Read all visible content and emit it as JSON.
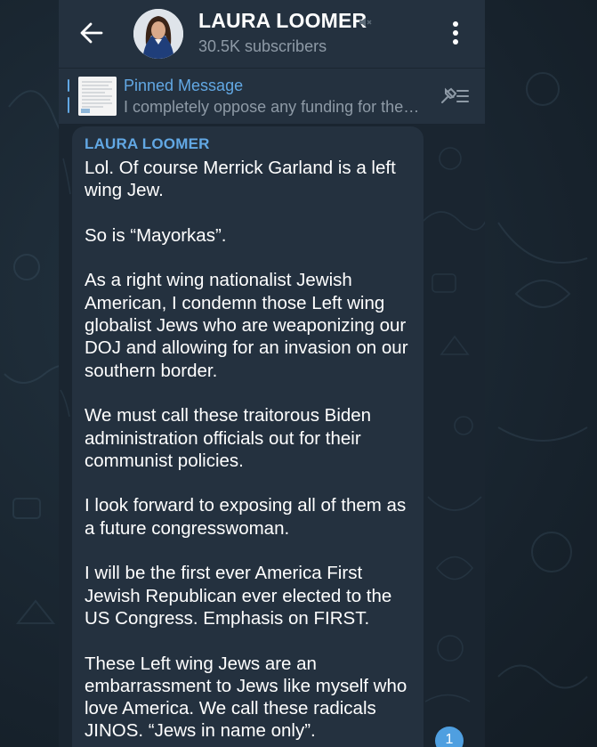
{
  "header": {
    "title": "LAURA LOOMER",
    "subscribers": "30.5K subscribers",
    "back_icon": "arrow-left-icon",
    "mute_icon": "muted-speaker-icon",
    "menu_icon": "more-vertical-icon"
  },
  "pinned": {
    "title": "Pinned Message",
    "preview": "I completely oppose any funding for the…",
    "list_icon": "pin-list-icon"
  },
  "message": {
    "sender": "LAURA LOOMER",
    "text": "Lol. Of course Merrick Garland is a left wing Jew.\n\nSo is “Mayorkas”.\n\nAs a right wing nationalist Jewish American, I condemn those Left wing globalist Jews who are weaponizing our DOJ and allowing for an invasion on our southern border.\n\nWe must call these traitorous Biden administration officials out for their communist policies.\n\nI look forward to exposing all of them as a future congresswoman.\n\nI will be the first ever America First Jewish Republican ever elected to the US Congress. Emphasis on FIRST.\n\nThese Left wing Jews are an embarrassment to Jews like myself who love America. We call these radicals JINOS. “Jews in name only”."
  },
  "scroll_badge": {
    "count": "1"
  },
  "colors": {
    "accent": "#62a8e4",
    "header_bg": "#24313f",
    "bubble_bg": "#24313f",
    "chat_bg": "#1a2530",
    "muted_text": "#8e9aa6"
  }
}
